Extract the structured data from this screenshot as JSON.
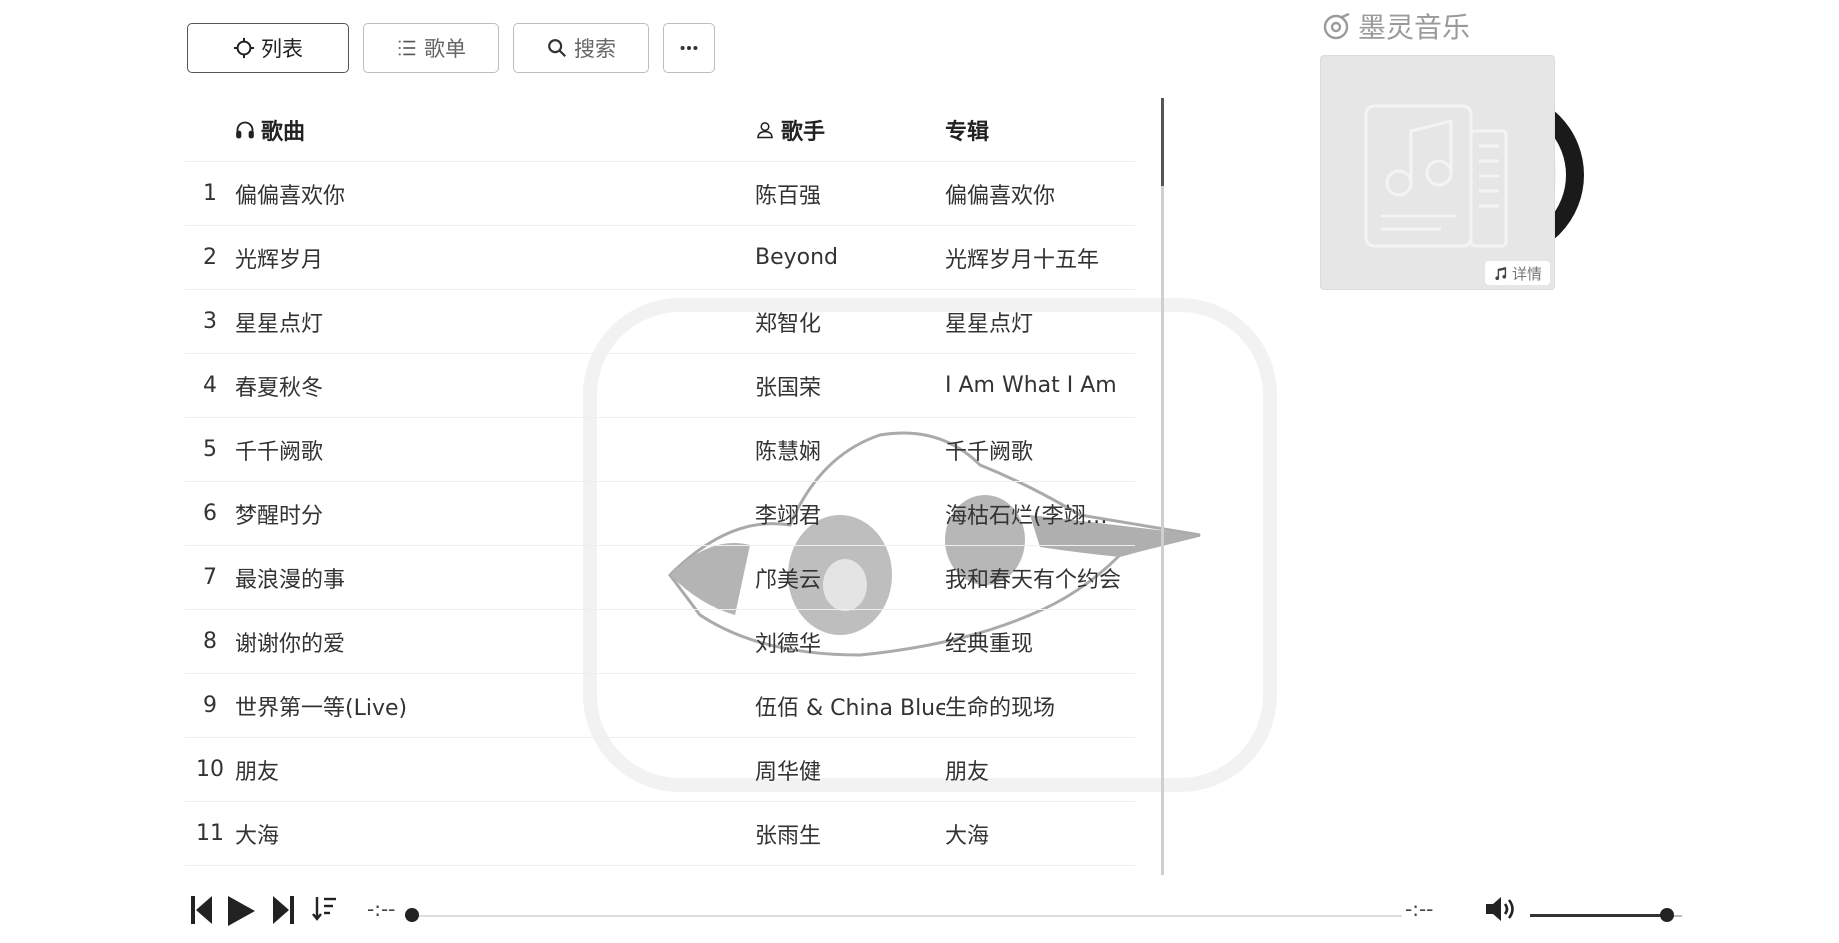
{
  "toolbar": {
    "list_label": "列表",
    "playlist_label": "歌单",
    "search_label": "搜索"
  },
  "list": {
    "headers": {
      "title": "歌曲",
      "artist": "歌手",
      "album": "专辑"
    },
    "rows": [
      {
        "num": "1",
        "title": "偏偏喜欢你",
        "artist": "陈百强",
        "album": "偏偏喜欢你"
      },
      {
        "num": "2",
        "title": "光辉岁月",
        "artist": "Beyond",
        "album": "光辉岁月十五年"
      },
      {
        "num": "3",
        "title": "星星点灯",
        "artist": "郑智化",
        "album": "星星点灯"
      },
      {
        "num": "4",
        "title": "春夏秋冬",
        "artist": "张国荣",
        "album": "I Am What I Am"
      },
      {
        "num": "5",
        "title": "千千阙歌",
        "artist": "陈慧娴",
        "album": "千千阙歌"
      },
      {
        "num": "6",
        "title": "梦醒时分",
        "artist": "李翊君",
        "album": "海枯石烂(李翊君..."
      },
      {
        "num": "7",
        "title": "最浪漫的事",
        "artist": "邝美云",
        "album": "我和春天有个约会"
      },
      {
        "num": "8",
        "title": "谢谢你的爱",
        "artist": "刘德华",
        "album": "经典重现"
      },
      {
        "num": "9",
        "title": "世界第一等(Live)",
        "artist": "伍佰 & China Blue",
        "album": "生命的现场"
      },
      {
        "num": "10",
        "title": "朋友",
        "artist": "周华健",
        "album": "朋友"
      },
      {
        "num": "11",
        "title": "大海",
        "artist": "张雨生",
        "album": "大海"
      }
    ]
  },
  "brand": {
    "name": "墨灵音乐"
  },
  "cover": {
    "detail_label": "详情"
  },
  "player": {
    "current_time": "-:--",
    "total_time": "-:--",
    "progress": 0,
    "volume": 0.88
  },
  "icons": {
    "list": "crosshair-icon",
    "playlist": "list-icon",
    "search": "search-icon",
    "more": "more-icon",
    "title_header": "headphones-icon",
    "artist_header": "user-icon",
    "prev": "skip-back-icon",
    "play": "play-icon",
    "next": "skip-forward-icon",
    "order": "play-order-icon",
    "volume": "volume-icon",
    "detail": "music-note-icon"
  }
}
